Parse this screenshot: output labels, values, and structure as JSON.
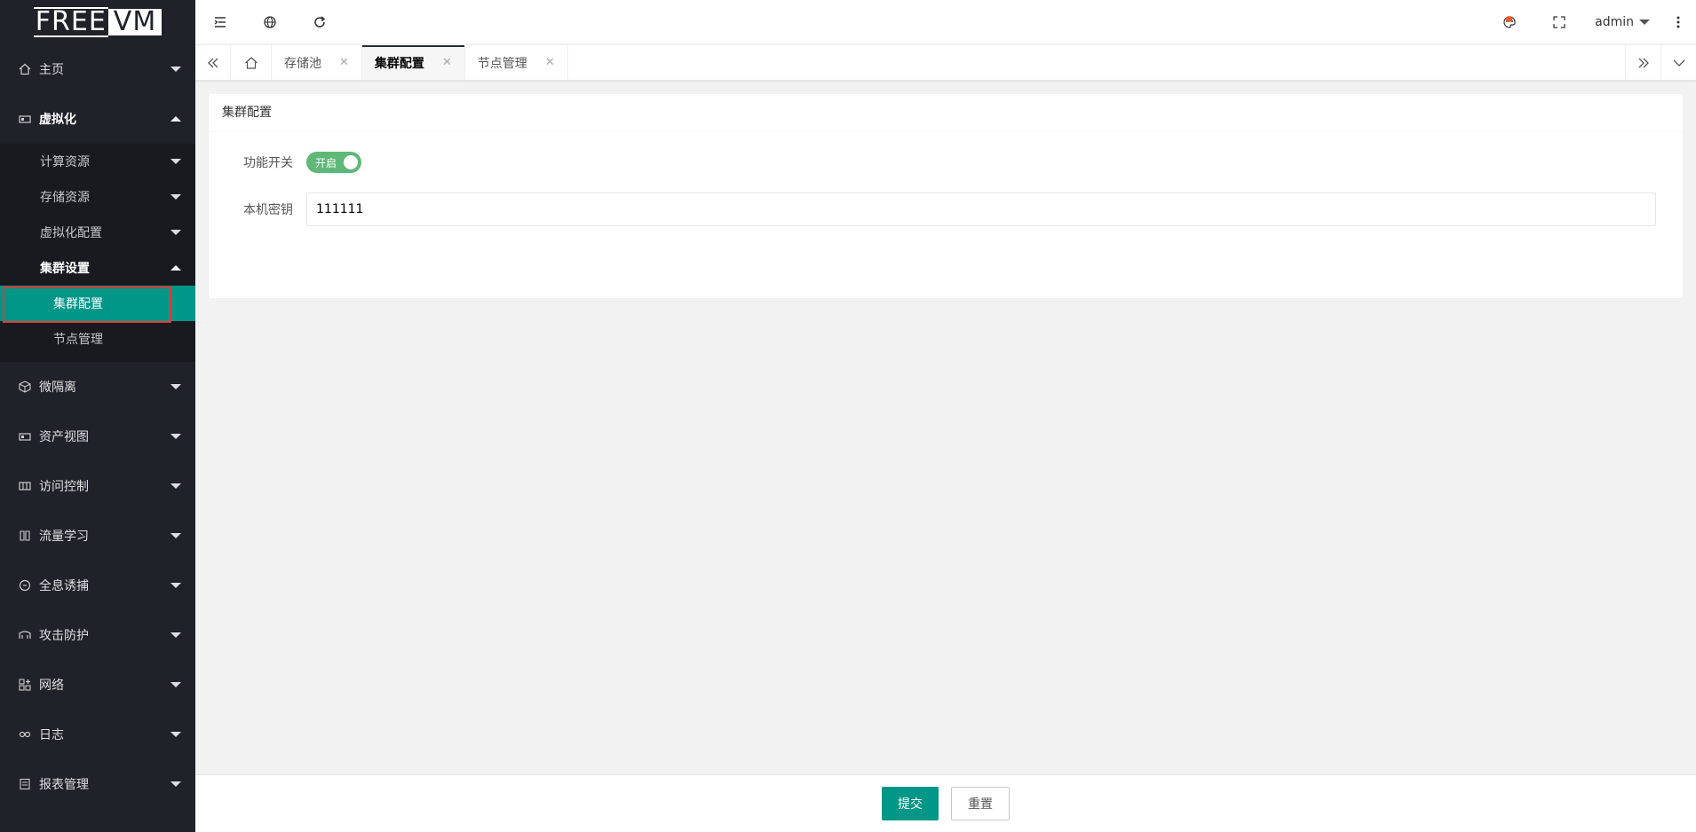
{
  "logo": {
    "part1": "FREE",
    "part2": "VM"
  },
  "sidebar": {
    "items": [
      {
        "label": "主页",
        "icon": "home-icon"
      },
      {
        "label": "虚拟化",
        "icon": "server-icon"
      },
      {
        "label": "微隔离",
        "icon": "cube-icon"
      },
      {
        "label": "资产视图",
        "icon": "assets-icon"
      },
      {
        "label": "访问控制",
        "icon": "grid-icon"
      },
      {
        "label": "流量学习",
        "icon": "book-icon"
      },
      {
        "label": "全息诱捕",
        "icon": "trap-icon"
      },
      {
        "label": "攻击防护",
        "icon": "shield-icon"
      },
      {
        "label": "网络",
        "icon": "network-icon"
      },
      {
        "label": "日志",
        "icon": "link-icon"
      },
      {
        "label": "报表管理",
        "icon": "report-icon"
      }
    ],
    "virtual_sub": [
      {
        "label": "计算资源"
      },
      {
        "label": "存储资源"
      },
      {
        "label": "虚拟化配置"
      },
      {
        "label": "集群设置"
      }
    ],
    "cluster_sub": [
      {
        "label": "集群配置"
      },
      {
        "label": "节点管理"
      }
    ]
  },
  "header": {
    "user": "admin"
  },
  "tabs": [
    {
      "label": "存储池"
    },
    {
      "label": "集群配置"
    },
    {
      "label": "节点管理"
    }
  ],
  "card": {
    "title": "集群配置",
    "switch_label": "功能开关",
    "switch_text": "开启",
    "key_label": "本机密钥",
    "key_value": "111111"
  },
  "footer": {
    "submit": "提交",
    "reset": "重置"
  },
  "colors": {
    "sidebar": "#20222a",
    "accent": "#009688",
    "switch_on": "#5fb878"
  }
}
